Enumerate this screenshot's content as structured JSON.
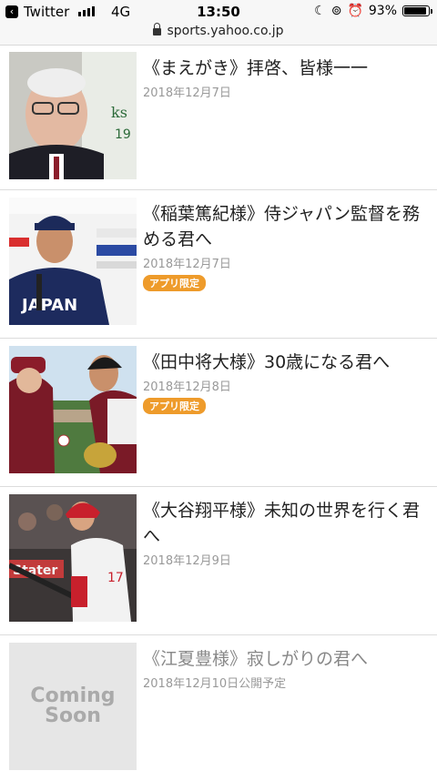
{
  "status_bar": {
    "back_app": "Twitter",
    "network": "4G",
    "time": "13:50",
    "battery": "93%",
    "url": "sports.yahoo.co.jp"
  },
  "articles": [
    {
      "title": "《まえがき》拝啓、皆様一一",
      "date": "2018年12月7日"
    },
    {
      "title": "《稲葉篤紀様》侍ジャパン監督を務める君へ",
      "date": "2018年12月7日",
      "badge": "アプリ限定"
    },
    {
      "title": "《田中将大様》30歳になる君へ",
      "date": "2018年12月8日",
      "badge": "アプリ限定"
    },
    {
      "title": "《大谷翔平様》未知の世界を行く君へ",
      "date": "2018年12月9日"
    },
    {
      "title": "《江夏豊様》寂しがりの君へ",
      "date": "2018年12月10日公開予定",
      "placeholder_line1": "Coming",
      "placeholder_line2": "Soon"
    }
  ]
}
